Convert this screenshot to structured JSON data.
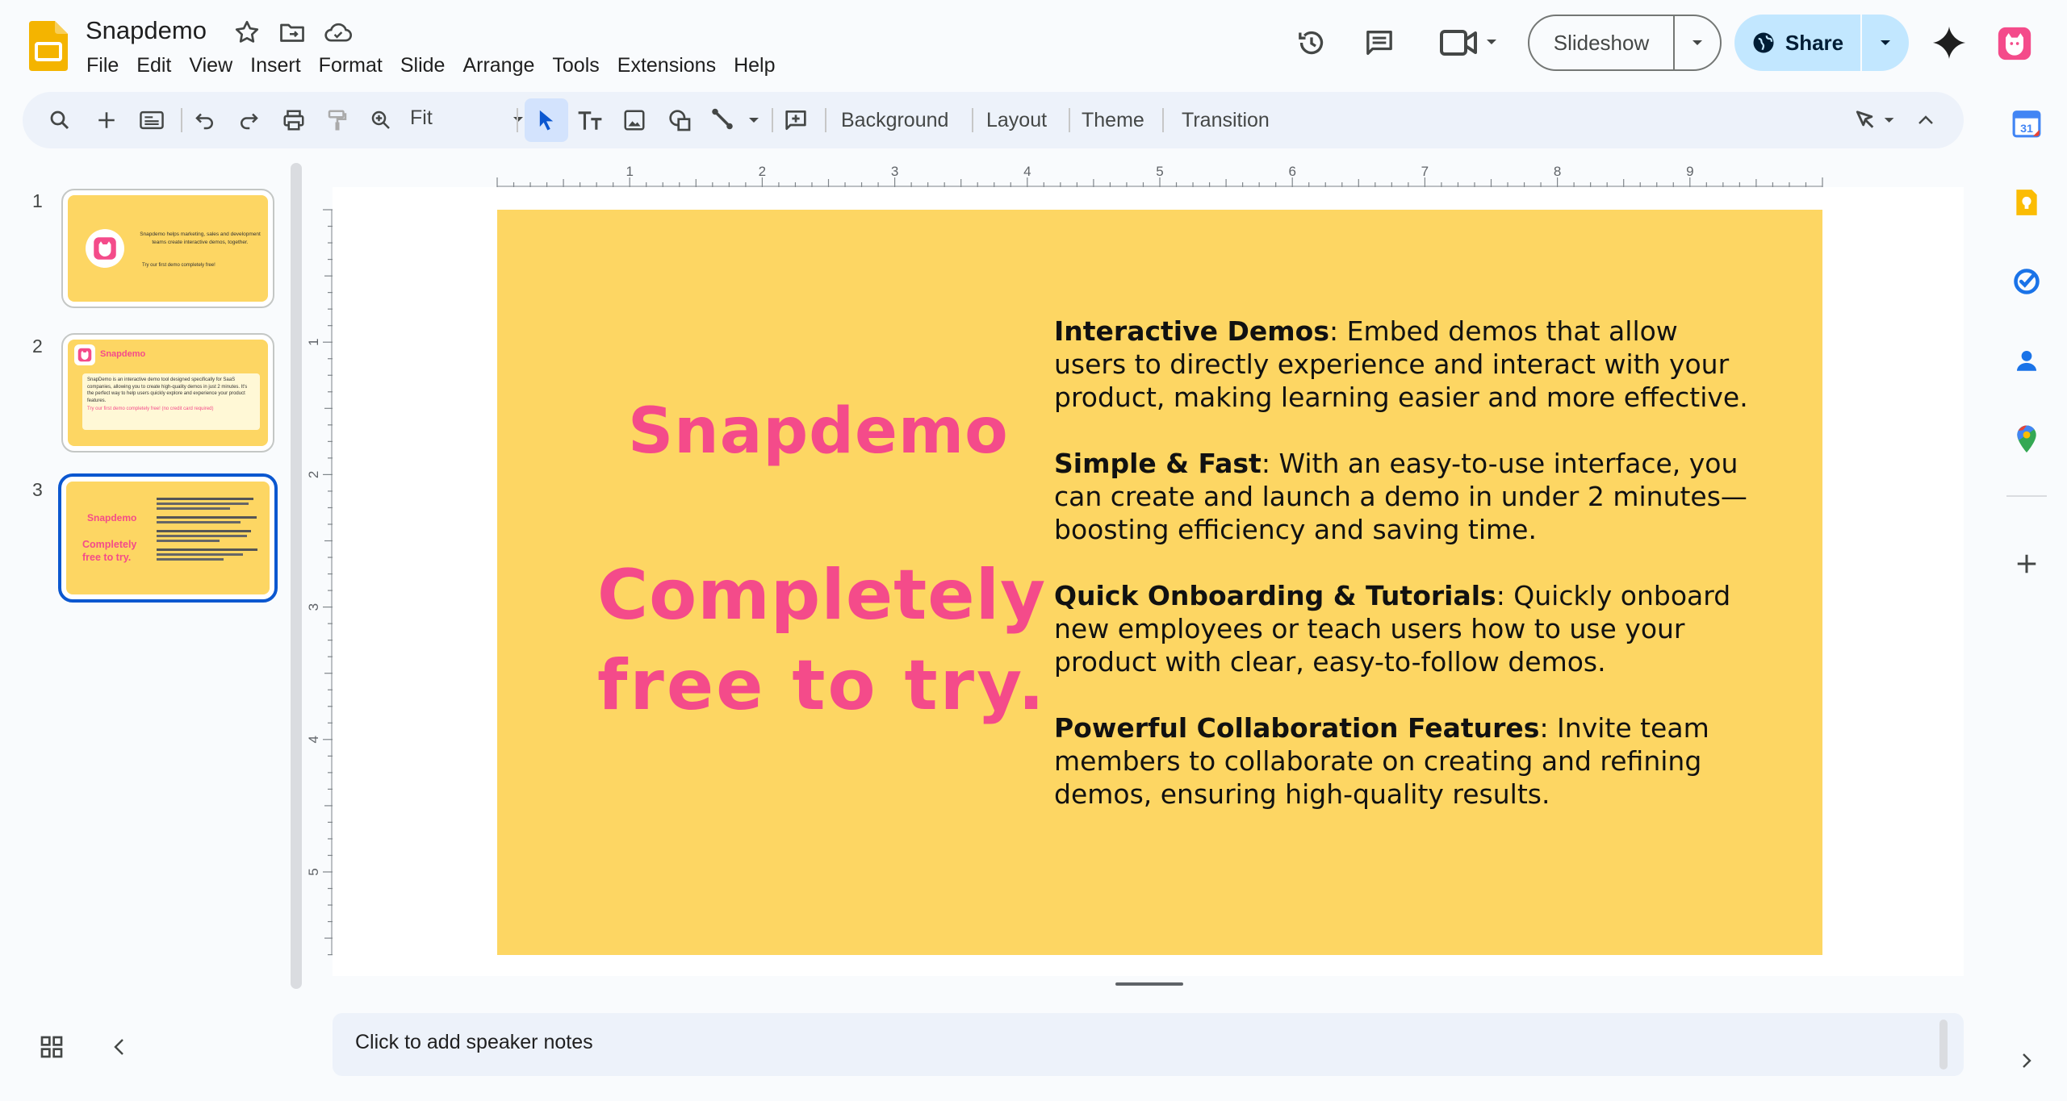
{
  "app": {
    "title": "Snapdemo",
    "menu": [
      "File",
      "Edit",
      "View",
      "Insert",
      "Format",
      "Slide",
      "Arrange",
      "Tools",
      "Extensions",
      "Help"
    ]
  },
  "header": {
    "slideshow_label": "Slideshow",
    "share_label": "Share"
  },
  "toolbar": {
    "zoom_value": "Fit",
    "background_label": "Background",
    "layout_label": "Layout",
    "theme_label": "Theme",
    "transition_label": "Transition"
  },
  "ruler": {
    "h_labels": [
      "1",
      "2",
      "3",
      "4",
      "5",
      "6",
      "7",
      "8",
      "9"
    ],
    "v_labels": [
      "1",
      "2",
      "3",
      "4",
      "5"
    ]
  },
  "slides": [
    {
      "number": "1",
      "text": "Snapdemo helps marketing, sales and development teams create interactive demos, together.",
      "cta": "Try our first demo completely free!"
    },
    {
      "number": "2",
      "brand": "Snapdemo",
      "text": "SnapDemo is an interactive demo tool designed specifically for SaaS companies, allowing you to create high-quality demos in just 2 minutes. It's the perfect way to help users quickly explore and experience your product features.",
      "cta": "Try our first demo completely free! (no credit card required)"
    },
    {
      "number": "3",
      "brand": "Snapdemo",
      "sub": "Completely free to try."
    }
  ],
  "current_slide": {
    "title": "Snapdemo",
    "subtitle_line1": "Completely",
    "subtitle_line2": "free to try.",
    "features": [
      {
        "heading": "Interactive Demos",
        "text": ": Embed demos that allow users to directly experience and interact with your product, making learning easier and more effective."
      },
      {
        "heading": "Simple & Fast",
        "text": ": With an easy-to-use interface, you can create and launch a demo in under 2 minutes—boosting efficiency and saving time."
      },
      {
        "heading": "Quick Onboarding & Tutorials",
        "text": ": Quickly onboard new employees or teach users how to use your product with clear, easy-to-follow demos."
      },
      {
        "heading": "Powerful Collaboration Features",
        "text": ": Invite team members to collaborate on creating and refining demos, ensuring high-quality results."
      }
    ]
  },
  "notes": {
    "placeholder": "Click to add speaker notes"
  },
  "side_panel": {
    "calendar_day": "31"
  },
  "colors": {
    "slide_bg": "#fdd663",
    "accent_pink": "#f44b8a",
    "share_bg": "#c2e7ff",
    "selection_blue": "#0b57d0"
  },
  "icons": [
    "slides-logo",
    "star-icon",
    "move-to-folder-icon",
    "cloud-saved-icon",
    "history-icon",
    "comment-icon",
    "meet-icon",
    "globe-icon",
    "gemini-icon",
    "snapdemo-extension-icon",
    "search-icon",
    "new-slide-icon",
    "undo-icon",
    "redo-icon",
    "print-icon",
    "paint-format-icon",
    "zoom-icon",
    "select-icon",
    "text-box-icon",
    "image-icon",
    "shape-icon",
    "line-icon",
    "add-comment-icon",
    "pen-icon",
    "collapse-icon",
    "grid-view-icon",
    "calendar-icon",
    "keep-icon",
    "tasks-icon",
    "contacts-icon",
    "maps-icon",
    "plus-icon"
  ]
}
